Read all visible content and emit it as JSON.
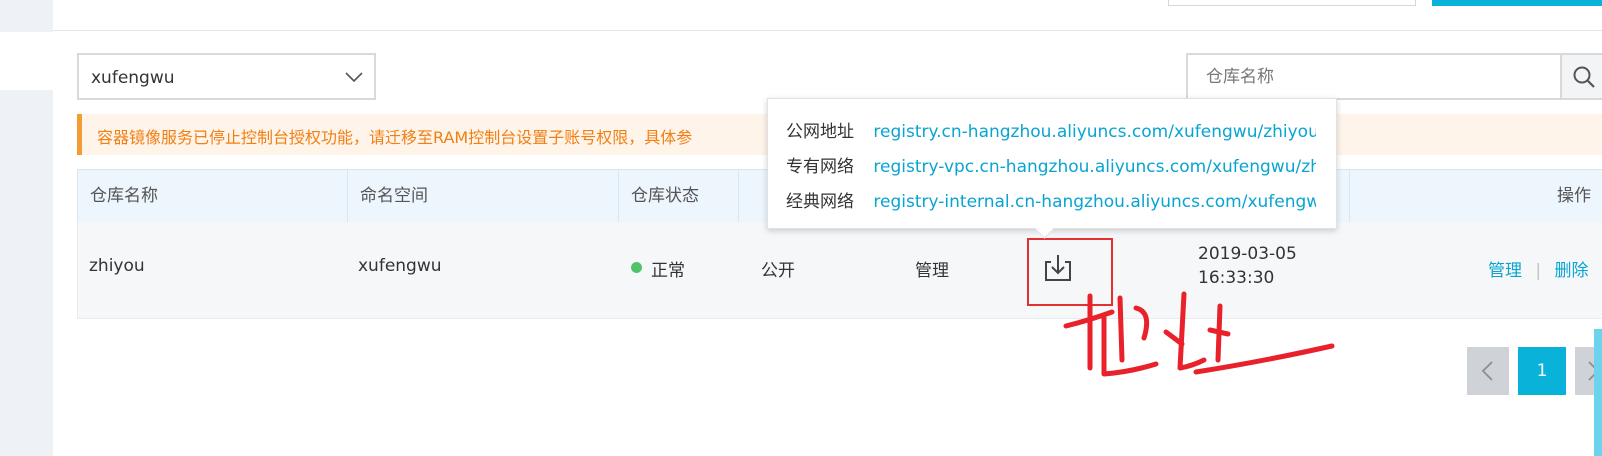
{
  "filters": {
    "namespace_value": "xufengwu",
    "search_placeholder": "仓库名称"
  },
  "warning": {
    "text": "容器镜像服务已停止控制台授权功能，请迁移至RAM控制台设置子账号权限，具体参"
  },
  "table": {
    "headers": {
      "repo_name": "仓库名称",
      "namespace": "命名空间",
      "repo_status": "仓库状态",
      "operation": "操作"
    },
    "rows": [
      {
        "repo_name": "zhiyou",
        "namespace": "xufengwu",
        "status": "正常",
        "visibility": "公开",
        "manage_label": "管理",
        "created_date": "2019-03-05",
        "created_time": "16:33:30",
        "op_manage": "管理",
        "op_separator": "|",
        "op_delete": "删除"
      }
    ]
  },
  "address_popover": {
    "public_label": "公网地址",
    "public_url": "registry.cn-hangzhou.aliyuncs.com/xufengwu/zhiyou",
    "vpc_label": "专有网络",
    "vpc_url": "registry-vpc.cn-hangzhou.aliyuncs.com/xufengwu/zhiyou",
    "classic_label": "经典网络",
    "classic_url": "registry-internal.cn-hangzhou.aliyuncs.com/xufengwu/zhiyou"
  },
  "annotation": {
    "handwritten_text": "地址"
  },
  "pagination": {
    "current_page": "1"
  },
  "colors": {
    "accent": "#09b2d8",
    "link": "#09a4d2",
    "warning_text": "#f27f14",
    "status_ok": "#53c36a",
    "annotation_red": "#e43030"
  }
}
